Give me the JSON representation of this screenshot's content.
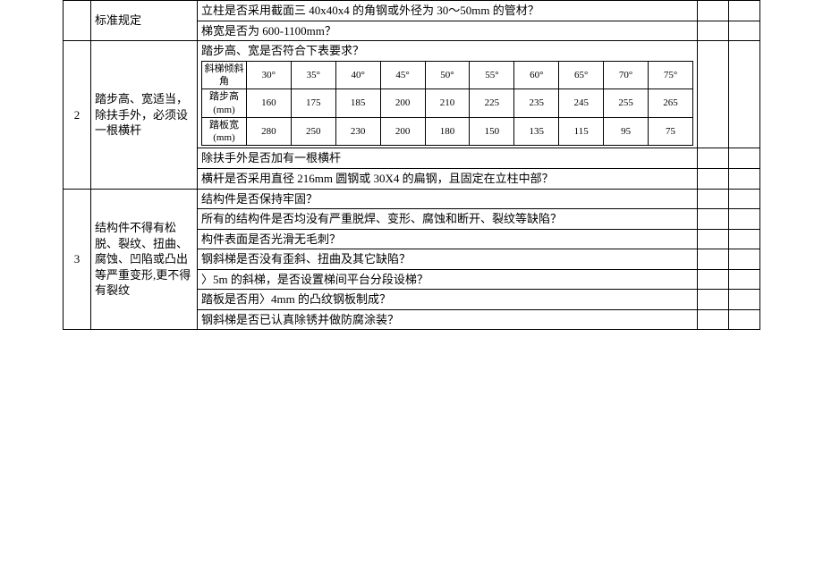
{
  "row1": {
    "idx": "",
    "req": "标准规定",
    "q1": "立柱是否采用截面三 40x40x4 的角钢或外径为 30～50mm 的管材？",
    "q2": "梯宽是否为 600-1100mm？"
  },
  "row2": {
    "idx": "2",
    "req": "踏步高、宽适当，除扶手外，必须设一根横杆",
    "q_top": "踏步高、宽是否符合下表要求？",
    "q_a": "除扶手外是否加有一根横杆",
    "q_b": "横杆是否采用直径 216mm 圆钢或 30X4 的扁钢，且固定在立柱中部？"
  },
  "row3": {
    "idx": "3",
    "req": "结构件不得有松脱、裂纹、扭曲、腐蚀、凹陷或凸出等严重变形,更不得有裂纹",
    "q1": "结构件是否保持牢固？",
    "q2": "所有的结构件是否均没有严重脱焊、变形、腐蚀和断开、裂纹等缺陷？",
    "q3": "构件表面是否光滑无毛刺？",
    "q4": "钢斜梯是否没有歪斜、扭曲及其它缺陷？",
    "q5": "〉5m 的斜梯，是否设置梯间平台分段设梯？",
    "q6": "踏板是否用〉4mm 的凸纹钢板制成？",
    "q7": "钢斜梯是否已认真除锈并做防腐涂装？"
  },
  "inner_table": {
    "h1": "斜梯倾斜角",
    "h2": "踏步高(mm)",
    "h3": "踏板宽(mm)",
    "angles": [
      "30°",
      "35°",
      "40°",
      "45°",
      "50°",
      "55°",
      "60°",
      "65°",
      "70°",
      "75°"
    ],
    "heights": [
      "160",
      "175",
      "185",
      "200",
      "210",
      "225",
      "235",
      "245",
      "255",
      "265"
    ],
    "widths": [
      "280",
      "250",
      "230",
      "200",
      "180",
      "150",
      "135",
      "115",
      "95",
      "75"
    ]
  }
}
